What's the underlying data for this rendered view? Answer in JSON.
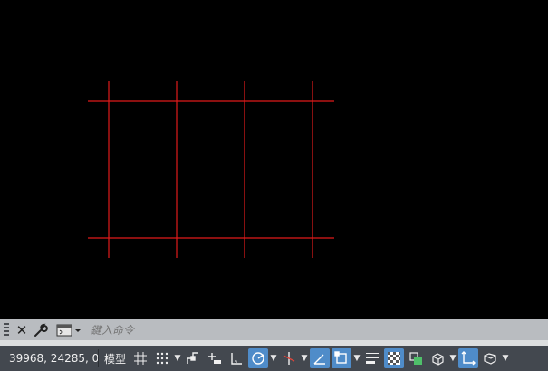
{
  "drawing": {
    "line_color": "#e01a1a",
    "background_color": "#000000"
  },
  "command_line": {
    "close_icon": "close-icon",
    "customize_icon": "wrench-icon",
    "recent_icon": "command-prompt-icon",
    "placeholder": "鍵入命令"
  },
  "status_bar": {
    "coordinates": "39968, 24285, 0",
    "model_tab": "模型",
    "toggles": [
      {
        "name": "grid-display",
        "active": false
      },
      {
        "name": "snap-mode",
        "active": false
      },
      {
        "name": "infer-constraints",
        "active": false
      },
      {
        "name": "dynamic-input",
        "active": false
      },
      {
        "name": "ortho-mode",
        "active": false
      },
      {
        "name": "polar-tracking",
        "active": true
      },
      {
        "name": "isometric-drafting",
        "active": false
      },
      {
        "name": "object-snap-tracking",
        "active": true
      },
      {
        "name": "object-snap",
        "active": true
      },
      {
        "name": "lineweight",
        "active": false
      },
      {
        "name": "transparency",
        "active": true
      },
      {
        "name": "selection-cycling",
        "active": false
      },
      {
        "name": "3d-object-snap",
        "active": false
      },
      {
        "name": "dynamic-ucs",
        "active": true
      },
      {
        "name": "selection-filter",
        "active": false
      }
    ],
    "active_color": "#4f8cc9"
  }
}
